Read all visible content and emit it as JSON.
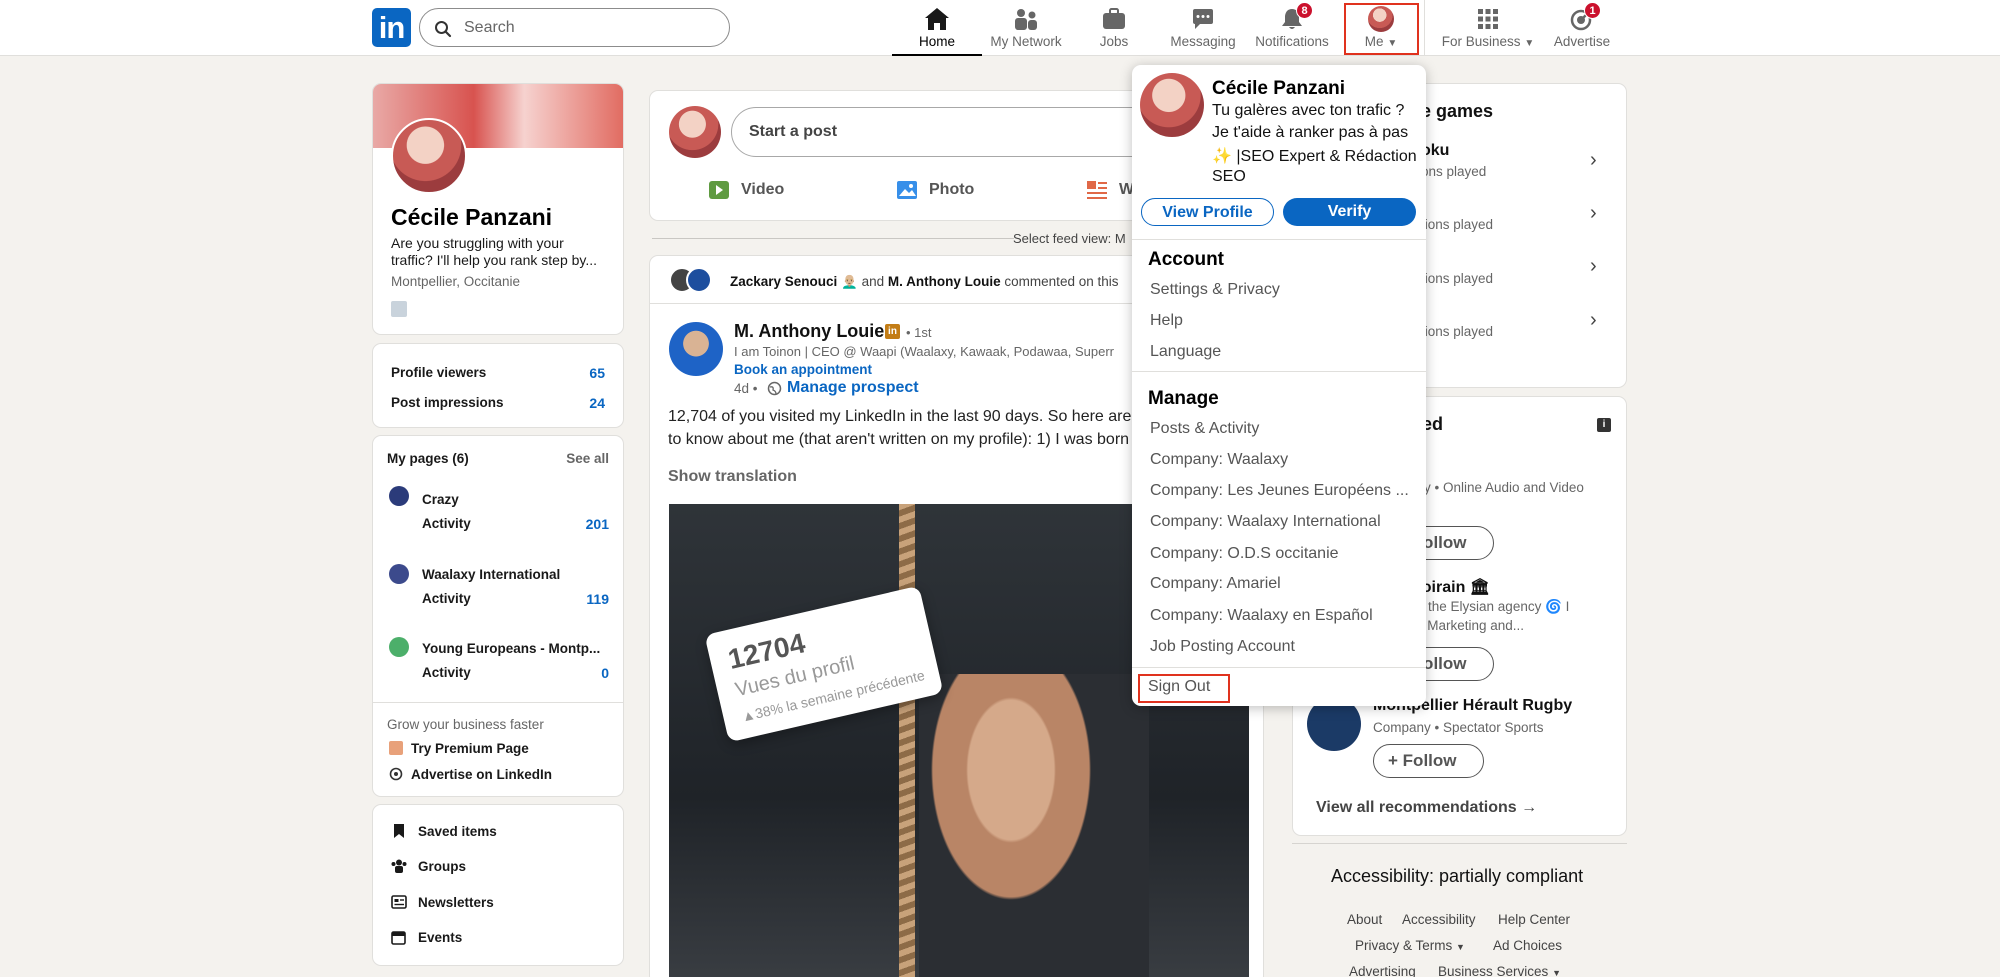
{
  "nav": {
    "search_placeholder": "Search",
    "items": [
      {
        "label": "Home"
      },
      {
        "label": "My Network"
      },
      {
        "label": "Jobs"
      },
      {
        "label": "Messaging"
      },
      {
        "label": "Notifications",
        "badge": "8"
      },
      {
        "label": "Me"
      },
      {
        "label": "For Business"
      },
      {
        "label": "Advertise",
        "badge": "1"
      }
    ]
  },
  "profile": {
    "name": "Cécile Panzani",
    "headline_1": "Are you struggling with your",
    "headline_2": "traffic? I'll help you rank step by...",
    "location": "Montpellier, Occitanie"
  },
  "stats": [
    {
      "label": "Profile viewers",
      "value": "65"
    },
    {
      "label": "Post impressions",
      "value": "24"
    }
  ],
  "pages": {
    "title": "My pages (6)",
    "see_all": "See all",
    "items": [
      {
        "name": "Crazy",
        "activity_label": "Activity",
        "count": "201"
      },
      {
        "name": "Waalaxy International",
        "activity_label": "Activity",
        "count": "119"
      },
      {
        "name": "Young Europeans - Montp...",
        "activity_label": "Activity",
        "count": "0"
      }
    ],
    "grow": "Grow your business faster",
    "premium": "Try Premium Page",
    "advertise": "Advertise on LinkedIn"
  },
  "shortcuts": [
    {
      "label": "Saved items"
    },
    {
      "label": "Groups"
    },
    {
      "label": "Newsletters"
    },
    {
      "label": "Events"
    }
  ],
  "composer": {
    "placeholder": "Start a post",
    "video": "Video",
    "photo": "Photo",
    "write_partial": "W"
  },
  "feed_view": "Select feed view: M",
  "post": {
    "social_actor_1": "Zackary Senouci",
    "social_and": "and",
    "social_actor_2": "M. Anthony Louie",
    "social_suffix": "commented on this",
    "author": "M. Anthony Louie",
    "degree": "• 1st",
    "author_headline": "I am Toinon | CEO @ Waapi (Waalaxy, Kawaak, Podawaa, Superr",
    "book": "Book an appointment",
    "age": "4d •",
    "manage": "Manage prospect",
    "body_1": "12,704 of you visited my LinkedIn in the last 90 days. So here are",
    "body_2": "to know about me (that aren't written on my profile): 1) I was born",
    "translation": "Show translation",
    "image_card_number": "12704",
    "image_card_line1": "Vues du profil",
    "image_card_line2": "▲38% la semaine précédente"
  },
  "right": {
    "games_title_partial": "e games",
    "games": [
      {
        "name_partial": "oku",
        "sub_partial": "ons played"
      },
      {
        "sub_partial": "tions played"
      },
      {
        "sub_partial": "tions played"
      },
      {
        "sub_partial": "tions played"
      }
    ],
    "rec_title_partial": "ed",
    "recs": [
      {
        "sub_partial": "y • Online Audio and Video",
        "follow": "Follow"
      },
      {
        "name_partial": "hoirain 🏛",
        "sub1_partial": "of the Elysian agency 🌀 I",
        "sub2_partial": "in Marketing and...",
        "follow": "Follow"
      },
      {
        "name": "Montpellier Hérault Rugby",
        "sub": "Company • Spectator Sports",
        "follow": "Follow"
      }
    ],
    "view_all": "View all recommendations"
  },
  "footer": {
    "accessibility": "Accessibility: partially compliant",
    "row1": [
      "About",
      "Accessibility",
      "Help Center"
    ],
    "row2": [
      "Privacy & Terms",
      "Ad Choices"
    ],
    "row3": [
      "Advertising",
      "Business Services"
    ]
  },
  "menu": {
    "name": "Cécile Panzani",
    "headline": [
      "Tu galères avec ton trafic ?",
      "Je t'aide à ranker pas à pas",
      "✨ |SEO Expert & Rédaction",
      "SEO"
    ],
    "view_profile": "View Profile",
    "verify": "Verify",
    "account_title": "Account",
    "account_items": [
      "Settings & Privacy",
      "Help",
      "Language"
    ],
    "manage_title": "Manage",
    "manage_items": [
      "Posts & Activity",
      "Company: Waalaxy",
      "Company: Les Jeunes Européens ...",
      "Company: Waalaxy International",
      "Company: O.D.S occitanie",
      "Company: Amariel",
      "Company: Waalaxy en Español",
      "Job Posting Account"
    ],
    "sign_out": "Sign Out"
  },
  "colors": {
    "brand": "#0a66c2",
    "badge": "#cb112d",
    "highlight": "#e0321e"
  }
}
